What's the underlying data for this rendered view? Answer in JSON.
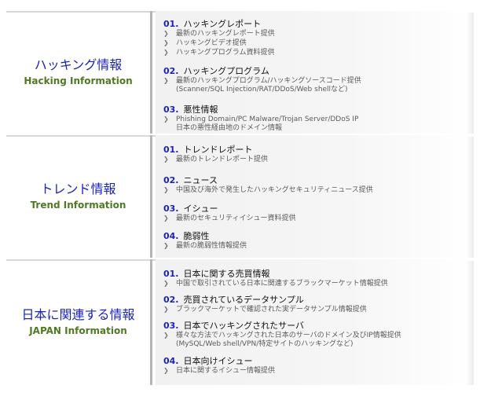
{
  "sections": [
    {
      "title_jp": "ハッキング情報",
      "title_en": "Hacking Information",
      "items": [
        {
          "num": "01.",
          "title": "ハッキングレポート",
          "subs": [
            "最新のハッキングレポート提供",
            "ハッキングビデオ提供",
            "ハッキングプログラム資料提供"
          ]
        },
        {
          "num": "02.",
          "title": "ハッキングプログラム",
          "subs": [
            "最新のハッキングプログラム/ハッキングソースコード提供"
          ],
          "cont": "(Scanner/SQL Injection/RAT/DDoS/Web shellなど)"
        },
        {
          "num": "03.",
          "title": "悪性情報",
          "subs": [
            "Phishing Domain/PC Malware/Trojan Server/DDoS IP"
          ],
          "cont": "日本の悪性経由地のドメイン情報"
        }
      ]
    },
    {
      "title_jp": "トレンド情報",
      "title_en": "Trend Information",
      "items": [
        {
          "num": "01.",
          "title": "トレンドレポート",
          "subs": [
            "最新のトレンドレポート提供"
          ]
        },
        {
          "num": "02.",
          "title": "ニュース",
          "subs": [
            "中国及び海外で発生したハッキングセキュリティニュース提供"
          ]
        },
        {
          "num": "03.",
          "title": "イシュー",
          "subs": [
            "最新のセキュリティイシュー資料提供"
          ]
        },
        {
          "num": "04.",
          "title": "脆弱性",
          "subs": [
            "最新の脆弱性情報提供"
          ]
        }
      ]
    },
    {
      "title_jp": "日本に関連する情報",
      "title_en": "JAPAN Information",
      "items": [
        {
          "num": "01.",
          "title": "日本に関する売買情報",
          "subs": [
            "中国で取引されている日本に関連するブラックマーケット情報提供"
          ]
        },
        {
          "num": "02.",
          "title": "売買されているデータサンプル",
          "subs": [
            "ブラックマーケットで確認された実データサンプル情報提供"
          ]
        },
        {
          "num": "03.",
          "title": "日本でハッキングされたサーバ",
          "subs": [
            "様々な方法でハッキングされた日本のサーバのドメイン及びIP情報提供"
          ],
          "cont": "(MySQL/Web shell/VPN/特定サイトのハッキングなど)"
        },
        {
          "num": "04.",
          "title": "日本向けイシュー",
          "subs": [
            "日本に関するイシュー情報提供"
          ]
        }
      ]
    }
  ]
}
